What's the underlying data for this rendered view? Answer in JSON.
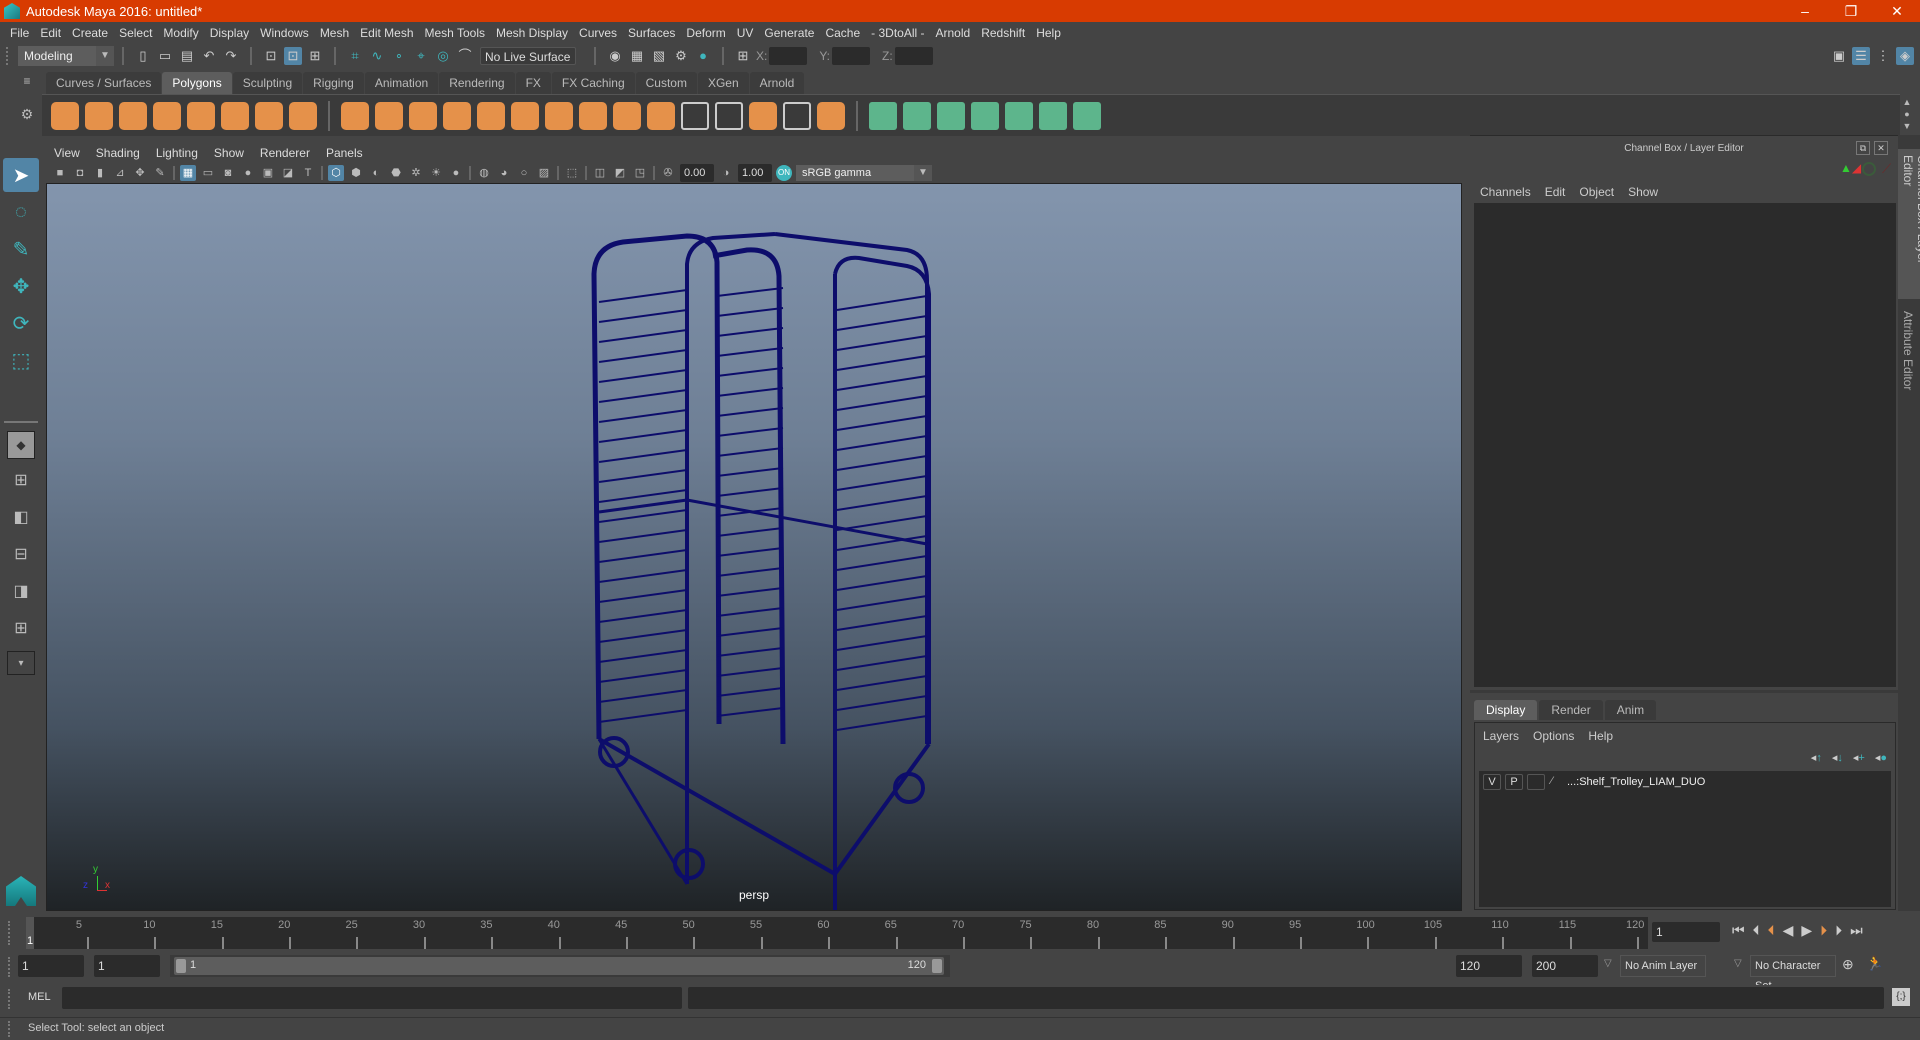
{
  "window": {
    "title": "Autodesk Maya 2016: untitled*",
    "minimize": "–",
    "restore": "❐",
    "close": "✕"
  },
  "menubar": [
    "File",
    "Edit",
    "Create",
    "Select",
    "Modify",
    "Display",
    "Windows",
    "Mesh",
    "Edit Mesh",
    "Mesh Tools",
    "Mesh Display",
    "Curves",
    "Surfaces",
    "Deform",
    "UV",
    "Generate",
    "Cache",
    "- 3DtoAll -",
    "Arnold",
    "Redshift",
    "Help"
  ],
  "statusline": {
    "mode": "Modeling",
    "live_surface": "No Live Surface",
    "x_label": "X:",
    "y_label": "Y:",
    "z_label": "Z:",
    "x_value": "",
    "y_value": "",
    "z_value": ""
  },
  "shelf_tabs": [
    "Curves / Surfaces",
    "Polygons",
    "Sculpting",
    "Rigging",
    "Animation",
    "Rendering",
    "FX",
    "FX Caching",
    "Custom",
    "XGen",
    "Arnold"
  ],
  "shelf_active": "Polygons",
  "shelf_icons": [
    {
      "name": "poly-sphere-icon",
      "style": "o"
    },
    {
      "name": "poly-cube-icon",
      "style": "o"
    },
    {
      "name": "poly-cylinder-icon",
      "style": "o"
    },
    {
      "name": "poly-cone-icon",
      "style": "o"
    },
    {
      "name": "poly-plane-icon",
      "style": "o"
    },
    {
      "name": "poly-torus-icon",
      "style": "o"
    },
    {
      "name": "poly-pyramid-icon",
      "style": "o"
    },
    {
      "name": "poly-pipe-icon",
      "style": "o"
    },
    {
      "name": "combine-icon",
      "style": "o"
    },
    {
      "name": "separate-icon",
      "style": "o"
    },
    {
      "name": "mirror-icon",
      "style": "o"
    },
    {
      "name": "smooth-icon",
      "style": "o"
    },
    {
      "name": "reduce-icon",
      "style": "o"
    },
    {
      "name": "remesh-icon",
      "style": "o"
    },
    {
      "name": "multi-cut-icon",
      "style": "o"
    },
    {
      "name": "extrude-icon",
      "style": "o"
    },
    {
      "name": "bridge-icon",
      "style": "o"
    },
    {
      "name": "bevel-icon",
      "style": "o"
    },
    {
      "name": "insert-edge-loop-icon",
      "style": "w"
    },
    {
      "name": "offset-edge-loop-icon",
      "style": "w"
    },
    {
      "name": "append-polygon-icon",
      "style": "o"
    },
    {
      "name": "target-weld-icon",
      "style": "w"
    },
    {
      "name": "fill-hole-icon",
      "style": "o"
    },
    {
      "name": "planar-mapping-icon",
      "style": "g"
    },
    {
      "name": "cylindrical-mapping-icon",
      "style": "g"
    },
    {
      "name": "spherical-mapping-icon",
      "style": "g"
    },
    {
      "name": "automatic-mapping-icon",
      "style": "g"
    },
    {
      "name": "unfold-icon",
      "style": "g"
    },
    {
      "name": "uv-editor-icon",
      "style": "g"
    },
    {
      "name": "sew-uv-icon",
      "style": "g"
    }
  ],
  "panel_menu": [
    "View",
    "Shading",
    "Lighting",
    "Show",
    "Renderer",
    "Panels"
  ],
  "panel_tools": {
    "exposure": "0.00",
    "gamma": "1.00",
    "color_space": "sRGB gamma"
  },
  "viewport": {
    "camera": "persp",
    "axis_x": "x",
    "axis_y": "y",
    "axis_z": "z",
    "wire_color": "#0d0d6b"
  },
  "channel_box": {
    "title": "Channel Box / Layer Editor",
    "menu": [
      "Channels",
      "Edit",
      "Object",
      "Show"
    ]
  },
  "layer_editor": {
    "tabs": [
      "Display",
      "Render",
      "Anim"
    ],
    "active_tab": "Display",
    "menu": [
      "Layers",
      "Options",
      "Help"
    ],
    "layers": [
      {
        "visible": "V",
        "playback": "P",
        "name": "...:Shelf_Trolley_LIAM_DUO"
      }
    ]
  },
  "side_tabs": [
    "Channel Box / Layer Editor",
    "Attribute Editor"
  ],
  "timeline": {
    "current_frame": "1",
    "ticks": [
      5,
      10,
      15,
      20,
      25,
      30,
      35,
      40,
      45,
      50,
      55,
      60,
      65,
      70,
      75,
      80,
      85,
      90,
      95,
      100,
      105,
      110,
      115,
      120
    ],
    "start": 1,
    "end": 120,
    "current_frame_field": "1"
  },
  "range": {
    "start_time": "1",
    "playback_start": "1",
    "range_start_label": "1",
    "range_end_label": "120",
    "playback_end": "120",
    "end_time": "200",
    "anim_layer": "No Anim Layer",
    "character_set": "No Character Set"
  },
  "command_line": {
    "label": "MEL",
    "input": "",
    "output": ""
  },
  "help_line": "Select Tool: select an object"
}
